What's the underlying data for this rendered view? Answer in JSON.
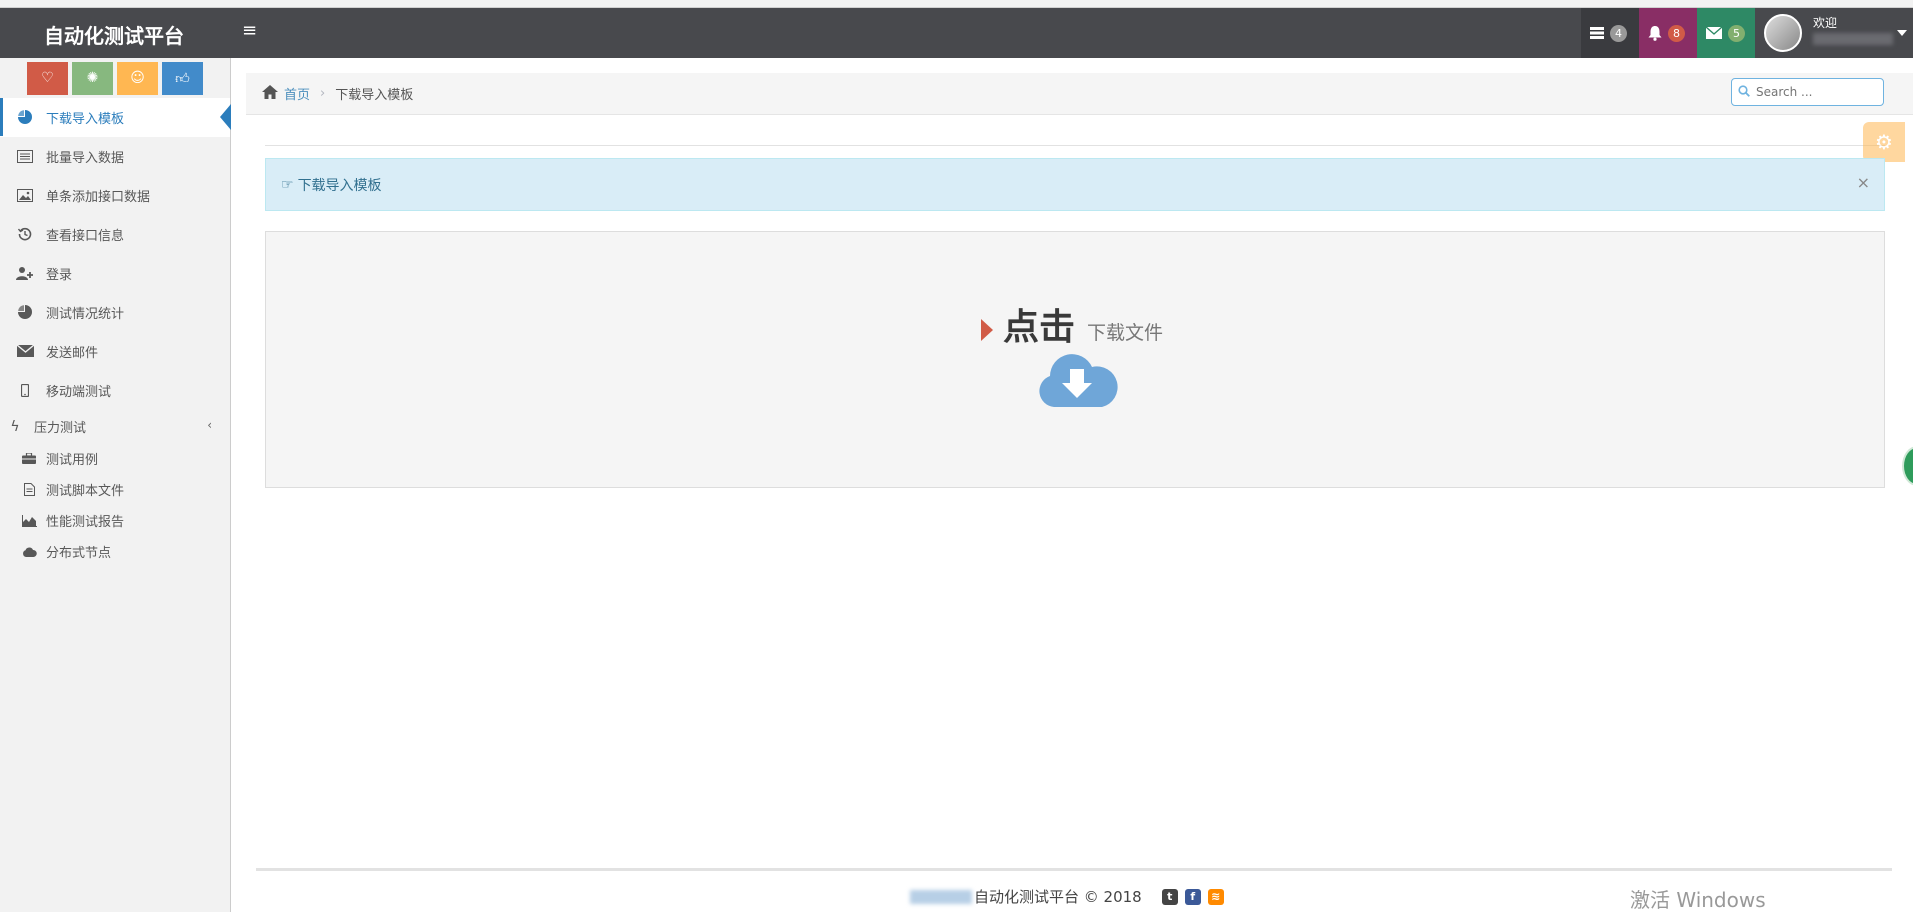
{
  "navbar": {
    "brand": "自动化测试平台",
    "toggle_icon": "≡",
    "tasks_badge": "4",
    "notifications_badge": "8",
    "messages_badge": "5",
    "welcome": "欢迎"
  },
  "sidebar": {
    "items": [
      {
        "label": "下载导入模板",
        "icon": "pie-chart-icon"
      },
      {
        "label": "批量导入数据",
        "icon": "list-icon"
      },
      {
        "label": "单条添加接口数据",
        "icon": "picture-icon"
      },
      {
        "label": "查看接口信息",
        "icon": "history-icon"
      },
      {
        "label": "登录",
        "icon": "user-plus-icon"
      },
      {
        "label": "测试情况统计",
        "icon": "pie-chart-icon"
      },
      {
        "label": "发送邮件",
        "icon": "envelope-icon"
      },
      {
        "label": "移动端测试",
        "icon": "mobile-icon"
      }
    ],
    "group_label": "压力测试",
    "sub_items": [
      {
        "label": "测试用例",
        "icon": "briefcase-icon"
      },
      {
        "label": "测试脚本文件",
        "icon": "file-icon"
      },
      {
        "label": "性能测试报告",
        "icon": "area-chart-icon"
      },
      {
        "label": "分布式节点",
        "icon": "cloud-icon"
      }
    ]
  },
  "breadcrumb": {
    "home": "首页",
    "current": "下载导入模板"
  },
  "search": {
    "placeholder": "Search ..."
  },
  "alert": {
    "text": "下载导入模板",
    "close": "×"
  },
  "download": {
    "big_text": "点击",
    "small_text": "下载文件"
  },
  "footer": {
    "text": "自动化测试平台 © 2018"
  },
  "watermark": "激活 Windows",
  "colors": {
    "navbar": "#48494d",
    "accent": "#2b7dbc",
    "alert_bg": "#d9edf7"
  }
}
